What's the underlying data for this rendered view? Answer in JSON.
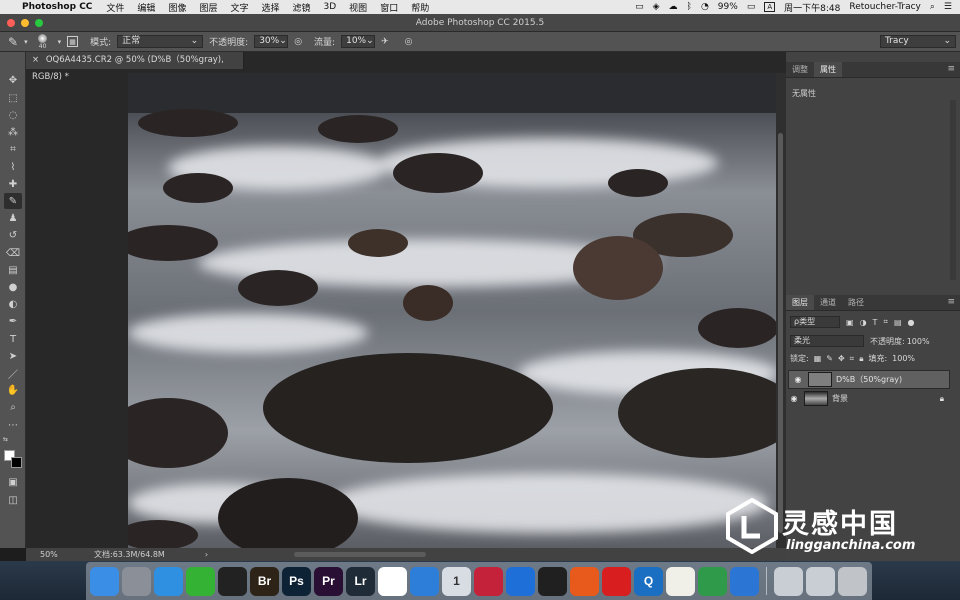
{
  "menubar": {
    "app": "Photoshop CC",
    "items": [
      "文件",
      "编辑",
      "图像",
      "图层",
      "文字",
      "选择",
      "滤镜",
      "3D",
      "视图",
      "窗口",
      "帮助"
    ],
    "battery": "99%",
    "input_badge": "A",
    "clock": "周一下午8:48",
    "user": "Retoucher-Tracy"
  },
  "window": {
    "title": "Adobe Photoshop CC 2015.5"
  },
  "options": {
    "brush_size": "40",
    "mode_label": "模式:",
    "mode_value": "正常",
    "opacity_label": "不透明度:",
    "opacity_value": "30%",
    "flow_label": "流量:",
    "flow_value": "10%",
    "workspace": "Tracy"
  },
  "document": {
    "tab": "OQ6A4435.CR2 @ 50% (D%B（50%gray), RGB/8) *"
  },
  "status": {
    "zoom": "50%",
    "doc_info": "文档:63.3M/64.8M",
    "arrow": "›"
  },
  "properties_panel": {
    "tabs": [
      "调整",
      "属性"
    ],
    "active_tab": "属性",
    "empty_text": "无属性"
  },
  "layers_panel": {
    "tabs": [
      "图层",
      "通道",
      "路径"
    ],
    "active_tab": "图层",
    "filter": "ρ类型",
    "blend_mode": "柔光",
    "opacity_label": "不透明度:",
    "opacity_value": "100%",
    "lock_label": "锁定:",
    "fill_label": "填充:",
    "fill_value": "100%",
    "layers": [
      {
        "name": "D%B（50%gray)",
        "selected": true
      },
      {
        "name": "背景",
        "selected": false
      }
    ]
  },
  "watermark": {
    "title": "灵感中国",
    "url": "lingganchina.com"
  },
  "dock": {
    "apps": [
      {
        "name": "finder",
        "label": "",
        "color": "#3a8ee6"
      },
      {
        "name": "launchpad",
        "label": "",
        "color": "#8a8f98"
      },
      {
        "name": "safari",
        "label": "",
        "color": "#2f8fe0"
      },
      {
        "name": "wechat",
        "label": "",
        "color": "#34b233"
      },
      {
        "name": "qq",
        "label": "",
        "color": "#222222"
      },
      {
        "name": "bridge",
        "label": "Br",
        "color": "#2d2316"
      },
      {
        "name": "photoshop",
        "label": "Ps",
        "color": "#0e2236"
      },
      {
        "name": "premiere",
        "label": "Pr",
        "color": "#2a0f35"
      },
      {
        "name": "lightroom",
        "label": "Lr",
        "color": "#1f2b36"
      },
      {
        "name": "baidu-netdisk",
        "label": "",
        "color": "#ffffff"
      },
      {
        "name": "screen-capture",
        "label": "",
        "color": "#2d7ed8"
      },
      {
        "name": "app-1",
        "label": "1",
        "color": "#d8dde3"
      },
      {
        "name": "davinci",
        "label": "",
        "color": "#c4223a"
      },
      {
        "name": "media-player",
        "label": "",
        "color": "#1f6fd8"
      },
      {
        "name": "obs",
        "label": "",
        "color": "#202020"
      },
      {
        "name": "app-orange",
        "label": "",
        "color": "#e85a1b"
      },
      {
        "name": "netease-music",
        "label": "",
        "color": "#d81e1e"
      },
      {
        "name": "quicktime",
        "label": "Q",
        "color": "#1a6fc2"
      },
      {
        "name": "notes",
        "label": "",
        "color": "#f0f0e8"
      },
      {
        "name": "numbers",
        "label": "",
        "color": "#2f9b4a"
      },
      {
        "name": "keynote",
        "label": "",
        "color": "#2b75d4"
      },
      {
        "name": "preview",
        "label": "",
        "color": "#c9ced4"
      },
      {
        "name": "screenshot",
        "label": "",
        "color": "#c9ced4"
      },
      {
        "name": "trash",
        "label": "",
        "color": "#c0c4c8"
      }
    ]
  },
  "colors": {
    "accent": "#5a5a5a",
    "panel": "#535353",
    "canvas_bg": "#282828"
  }
}
